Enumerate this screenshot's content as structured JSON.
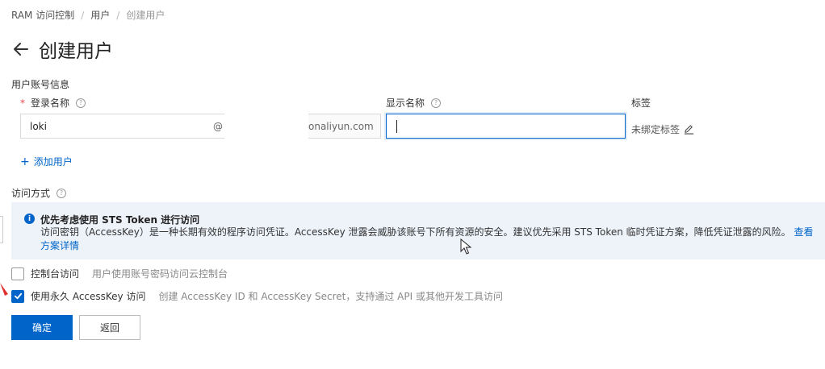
{
  "breadcrumb": {
    "items": [
      "RAM 访问控制",
      "用户",
      "创建用户"
    ],
    "separator": "/"
  },
  "header": {
    "title": "创建用户"
  },
  "account_section": {
    "label": "用户账号信息",
    "login_name_label": "登录名称",
    "login_name_value": "loki",
    "at_sign": "@",
    "domain_suffix": "onaliyun.com",
    "display_name_label": "显示名称",
    "display_name_value": "",
    "tag_label": "标签",
    "tag_value": "未绑定标签",
    "add_user_label": "添加用户"
  },
  "access_section": {
    "label": "访问方式",
    "notice": {
      "title": "优先考虑使用 STS Token 进行访问",
      "body": "访问密钥（AccessKey）是一种长期有效的程序访问凭证。AccessKey 泄露会威胁该账号下所有资源的安全。建议优先采用 STS Token 临时凭证方案，降低凭证泄露的风险。",
      "link": "查看方案详情"
    },
    "options": [
      {
        "label": "控制台访问",
        "description": "用户使用账号密码访问云控制台",
        "checked": false
      },
      {
        "label": "使用永久 AccessKey 访问",
        "description": "创建 AccessKey ID 和 AccessKey Secret，支持通过 API 或其他开发工具访问",
        "checked": true
      }
    ]
  },
  "actions": {
    "confirm_label": "确定",
    "back_label": "返回"
  },
  "colors": {
    "primary": "#0064c8",
    "info_bg": "#eef3fa",
    "required": "#e5484d"
  },
  "icons": [
    "back-arrow-icon",
    "help-icon",
    "edit-icon",
    "info-icon",
    "plus-icon",
    "check-icon",
    "mouse-cursor-icon"
  ]
}
